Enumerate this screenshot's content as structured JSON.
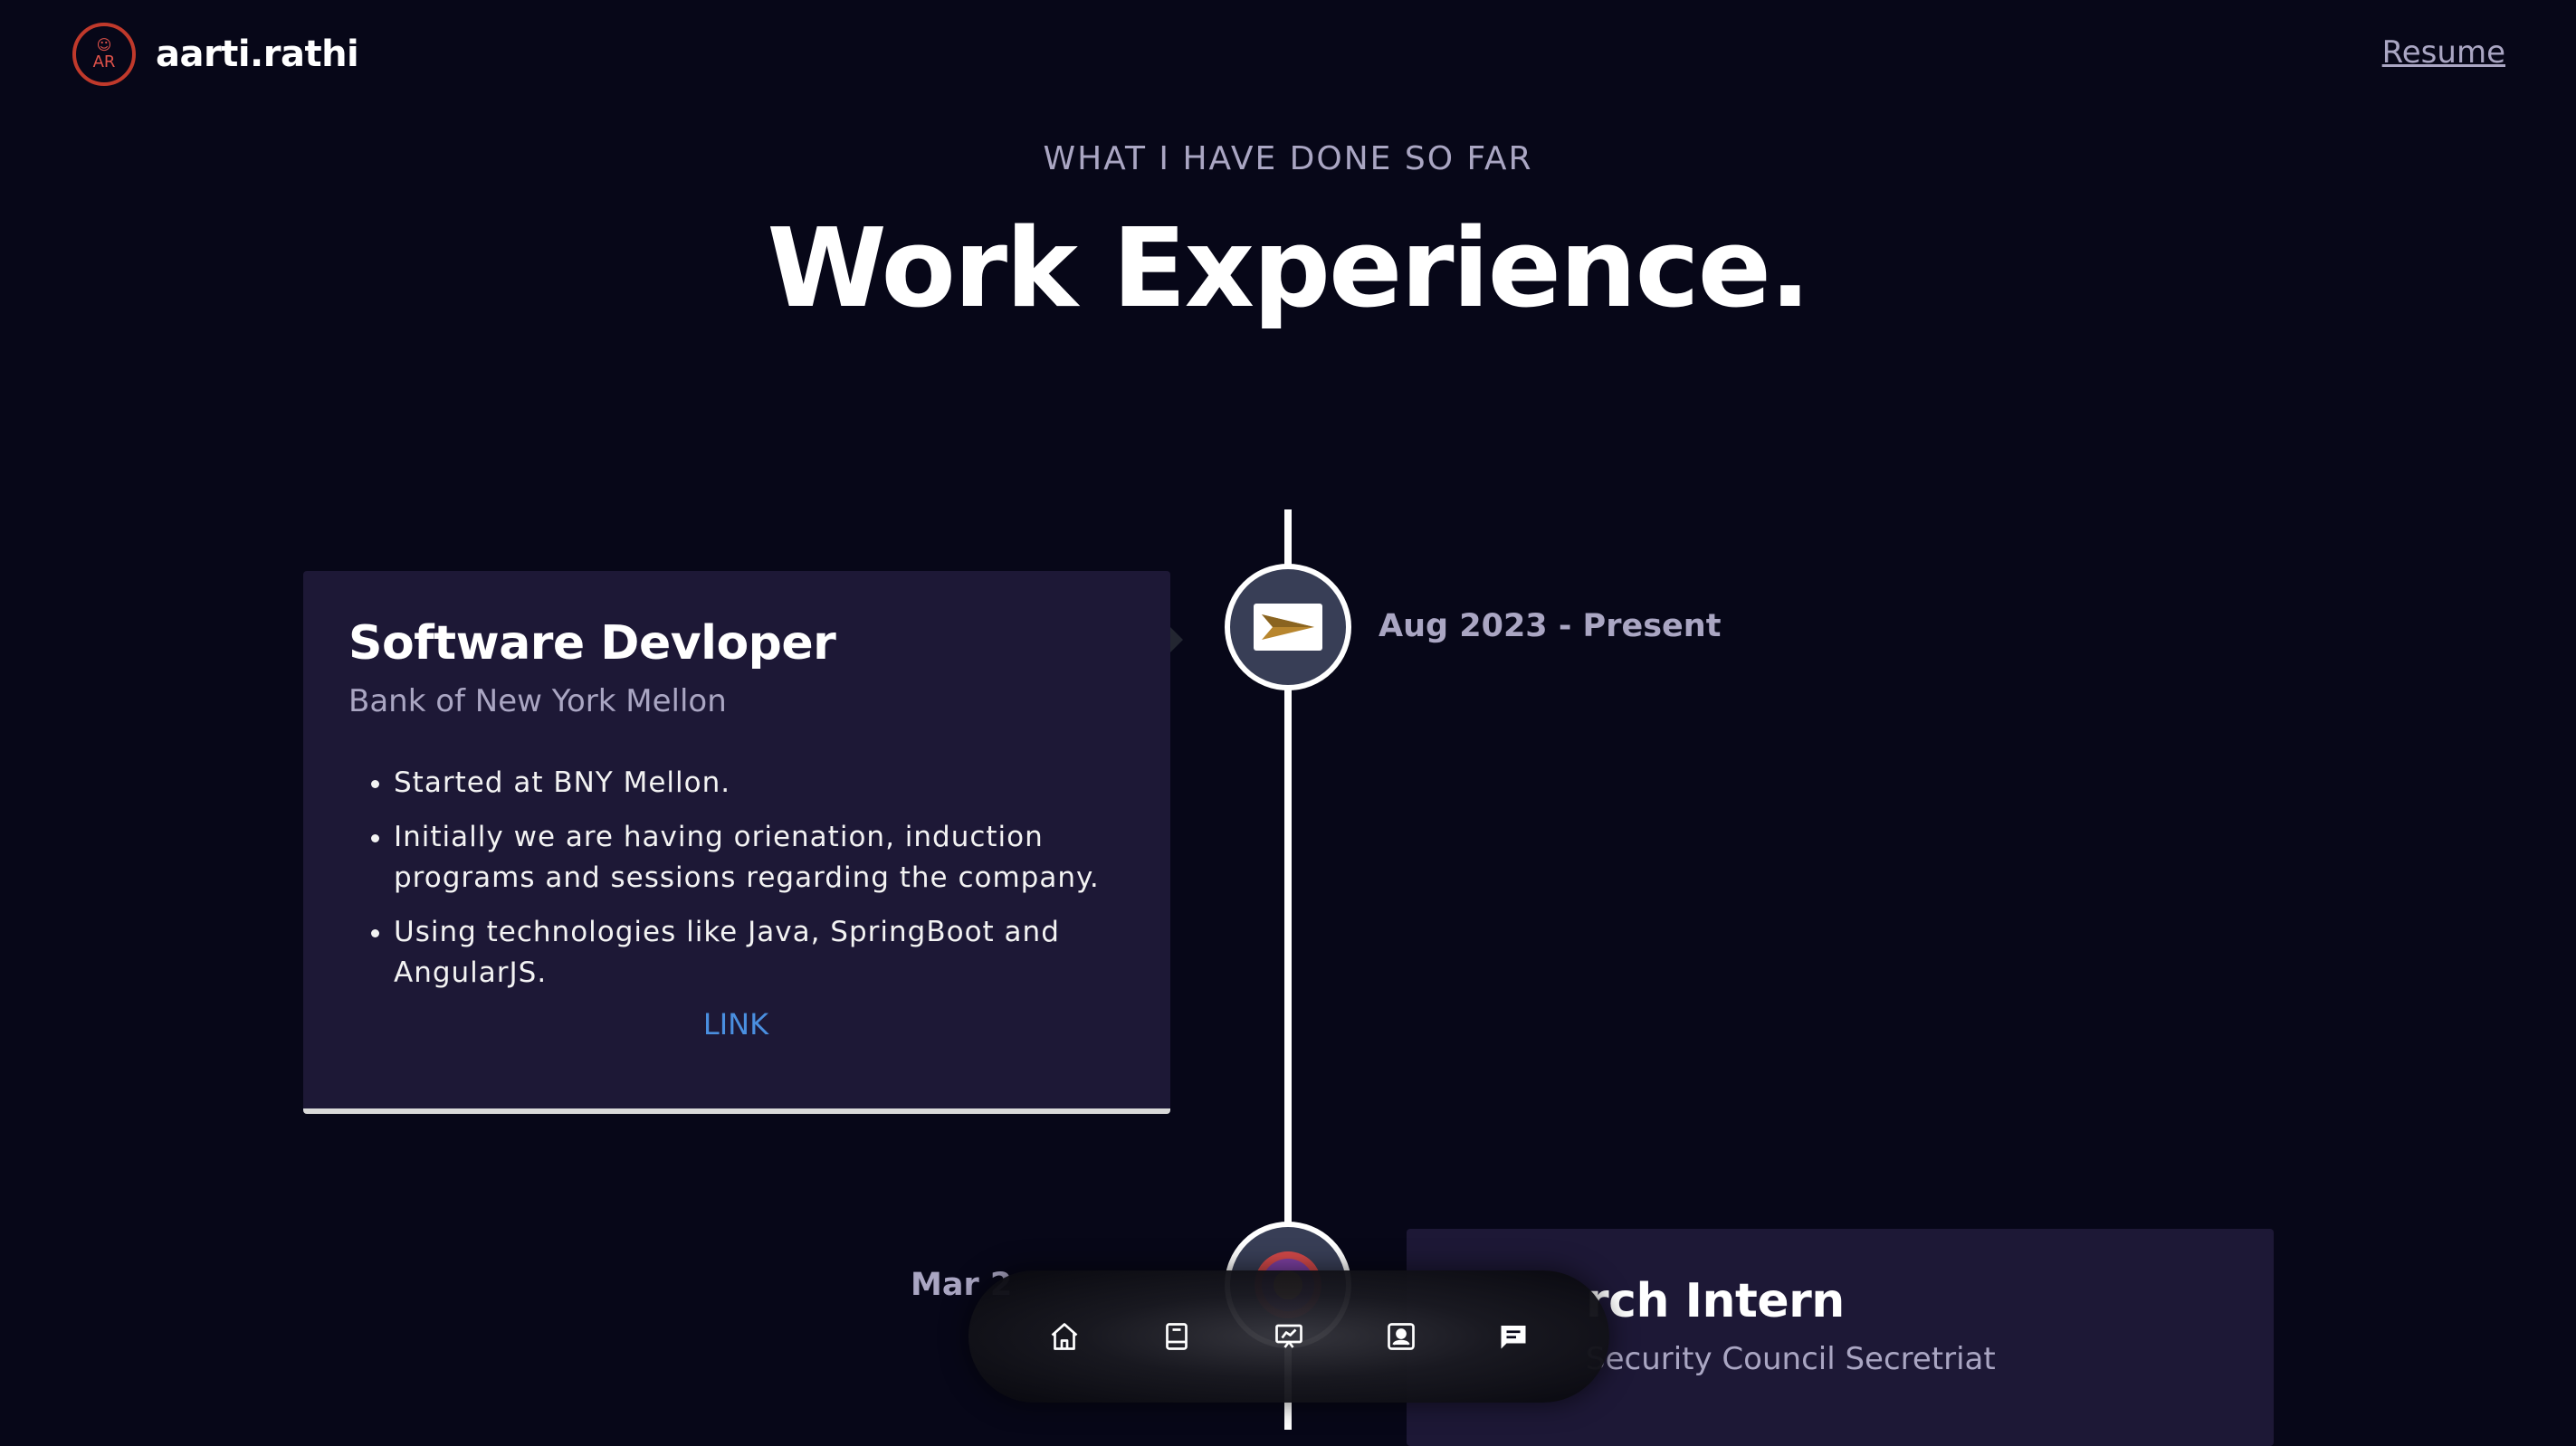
{
  "header": {
    "logo_text": "AR",
    "brand": "aarti.rathi",
    "resume_label": "Resume"
  },
  "section": {
    "subtitle": "WHAT I HAVE DONE SO FAR",
    "title": "Work Experience."
  },
  "experiences": [
    {
      "title": "Software Devloper",
      "company": "Bank of New York Mellon",
      "date": "Aug 2023 - Present",
      "icon": "bny-mellon-logo",
      "points": [
        "Started at BNY Mellon.",
        "Initially we are having orienation, induction programs and sessions regarding the company.",
        "Using technologies like Java, SpringBoot and AngularJS."
      ],
      "link_label": "LINK"
    },
    {
      "title": "rch Intern",
      "company": "Security Council Secretriat",
      "date": "Mar 2",
      "icon": "nscs-logo"
    }
  ],
  "dock": {
    "items": [
      "home-icon",
      "book-icon",
      "presentation-icon",
      "contact-card-icon",
      "message-icon"
    ]
  },
  "colors": {
    "background": "#070718",
    "card": "#1d1836",
    "secondary_text": "#aaa6c3",
    "link": "#4a8fe0",
    "logo_ring": "#c0392b"
  }
}
